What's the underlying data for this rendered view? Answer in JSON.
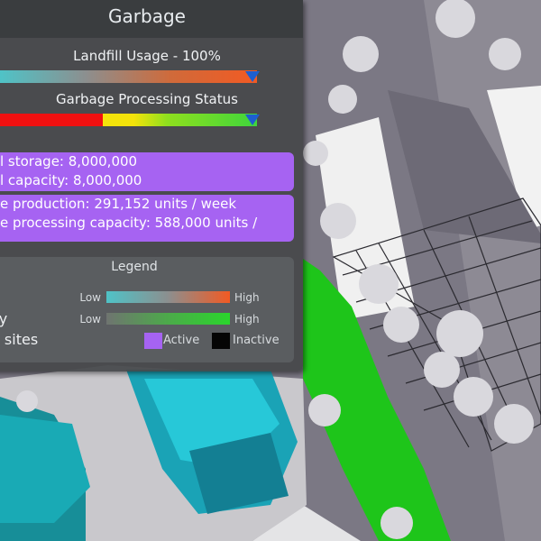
{
  "panel": {
    "title": "Garbage",
    "landfill_label": "Landfill Usage - 100%",
    "landfill_value": 1.0,
    "processing_label": "Garbage Processing Status",
    "processing_value": 1.0
  },
  "storage_box": {
    "line1": "l storage: 8,000,000",
    "line2": "l capacity: 8,000,000"
  },
  "production_box": {
    "line1": "e production: 291,152 units / week",
    "line2": "e processing capacity: 588,000 units /"
  },
  "legend": {
    "title": "Legend",
    "rows": [
      {
        "label": "",
        "low": "Low",
        "high": "High"
      },
      {
        "label": "cy",
        "low": "Low",
        "high": "High"
      },
      {
        "label": "e sites"
      }
    ],
    "active_label": "Active",
    "inactive_label": "Inactive"
  },
  "colors": {
    "active": "#a663f2",
    "inactive": "#050505",
    "landfill_start": "#4fc3c7",
    "landfill_end": "#f25a23",
    "processing_red": "#f01010",
    "processing_yellow": "#f4e30a",
    "processing_green": "#3fd53c",
    "grass": "#1ec51a",
    "building": "#19b6c9"
  },
  "icons": {
    "marker": "triangle-down-marker"
  }
}
